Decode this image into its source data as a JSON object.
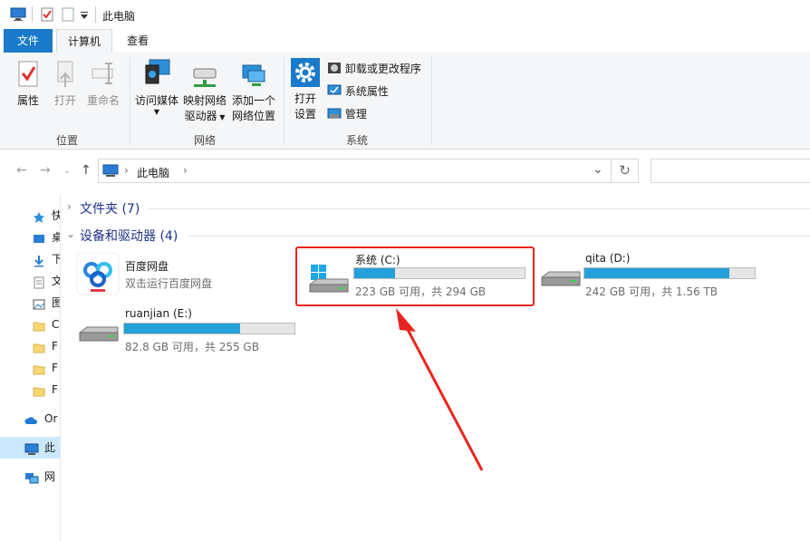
{
  "window": {
    "title": "此电脑"
  },
  "tabs": {
    "file": "文件",
    "computer": "计算机",
    "view": "查看"
  },
  "ribbon": {
    "location": {
      "label": "位置",
      "properties": "属性",
      "open": "打开",
      "rename": "重命名"
    },
    "network": {
      "label": "网络",
      "access_media": "访问媒体",
      "map_drive_1": "映射网络",
      "map_drive_2": "驱动器",
      "add_location_1": "添加一个",
      "add_location_2": "网络位置"
    },
    "system": {
      "label": "系统",
      "open_settings_1": "打开",
      "open_settings_2": "设置",
      "uninstall": "卸载或更改程序",
      "sys_props": "系统属性",
      "manage": "管理"
    }
  },
  "address": {
    "path": "此电脑",
    "separator": "›"
  },
  "navpane": {
    "items": [
      {
        "label": "快",
        "icon": "star-icon"
      },
      {
        "label": "桌",
        "icon": "desktop-icon"
      },
      {
        "label": "下",
        "icon": "download-icon"
      },
      {
        "label": "文",
        "icon": "document-icon"
      },
      {
        "label": "图",
        "icon": "picture-icon"
      },
      {
        "label": "C",
        "icon": "folder-icon"
      },
      {
        "label": "F",
        "icon": "folder-icon"
      },
      {
        "label": "F",
        "icon": "folder-icon"
      },
      {
        "label": "F",
        "icon": "folder-icon"
      },
      {
        "label": "Or",
        "icon": "cloud-icon"
      },
      {
        "label": "此",
        "icon": "computer-icon"
      },
      {
        "label": "网",
        "icon": "network-icon"
      }
    ]
  },
  "sections": {
    "folders": "文件夹 (7)",
    "devices": "设备和驱动器 (4)"
  },
  "devices": {
    "baidu": {
      "name": "百度网盘",
      "sub": "双击运行百度网盘"
    },
    "c": {
      "name": "系统 (C:)",
      "info": "223 GB 可用，共 294 GB",
      "used_fraction": 0.24
    },
    "d": {
      "name": "qita (D:)",
      "info": "242 GB 可用，共 1.56 TB",
      "used_fraction": 0.85
    },
    "e": {
      "name": "ruanjian (E:)",
      "info": "82.8 GB 可用，共 255 GB",
      "used_fraction": 0.68
    }
  },
  "colors": {
    "accent": "#1979ca",
    "bar_fill": "#26a0da",
    "highlight": "#e8251f"
  }
}
